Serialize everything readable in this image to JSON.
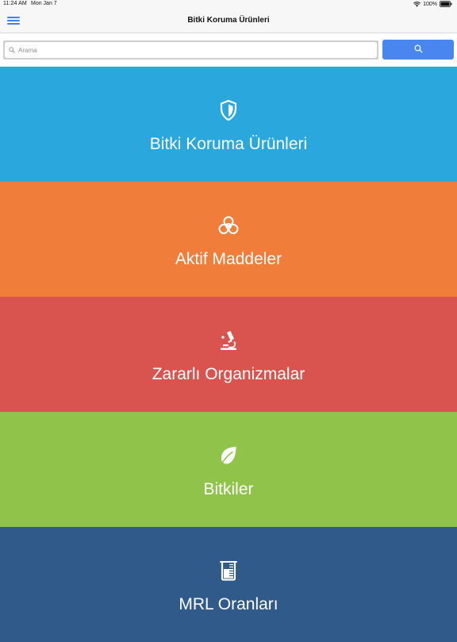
{
  "status_bar": {
    "time": "11:24 AM",
    "date": "Mon Jan 7",
    "battery": "100%",
    "icons": [
      "wifi-icon",
      "battery-icon"
    ]
  },
  "nav": {
    "title": "Bitki Koruma Ürünleri",
    "menu_icon": "hamburger-menu-icon"
  },
  "search": {
    "placeholder": "Arama",
    "value": "",
    "button_icon": "search-icon"
  },
  "categories": [
    {
      "label": "Bitki Koruma Ürünleri",
      "icon": "shield-icon",
      "color": "#2aa8de"
    },
    {
      "label": "Aktif Maddeler",
      "icon": "biohazard-icon",
      "color": "#f07d3a"
    },
    {
      "label": "Zararlı Organizmalar",
      "icon": "microscope-icon",
      "color": "#d9534f"
    },
    {
      "label": "Bitkiler",
      "icon": "leaf-icon",
      "color": "#8fc34a"
    },
    {
      "label": "MRL Oranları",
      "icon": "beaker-icon",
      "color": "#305a8a"
    }
  ],
  "colors": {
    "accent": "#4a86f0"
  }
}
